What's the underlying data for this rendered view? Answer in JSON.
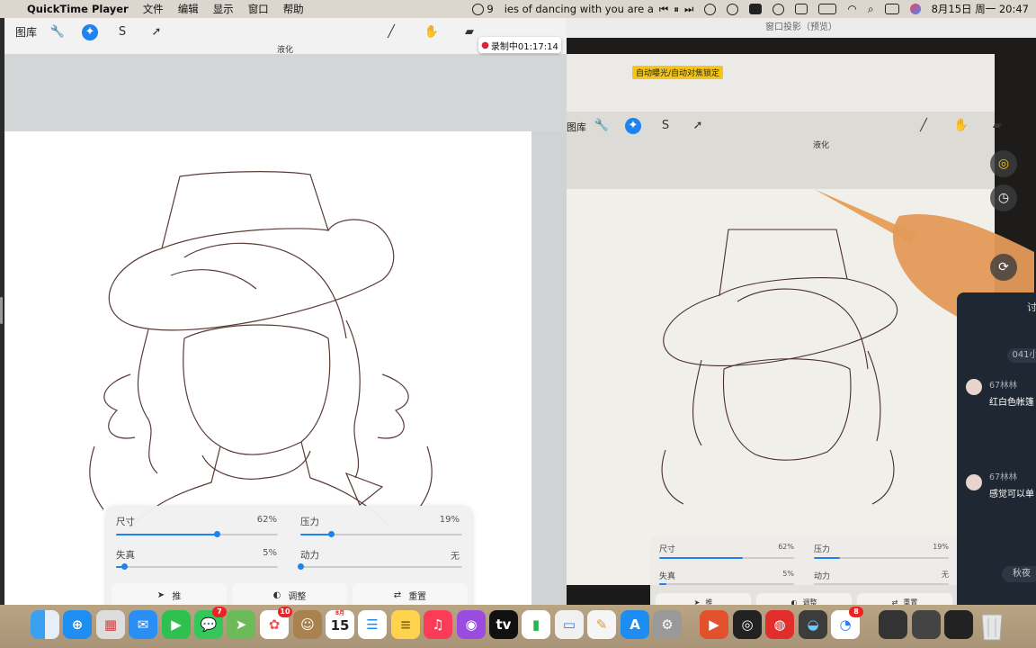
{
  "menubar": {
    "app_name": "QuickTime Player",
    "menus": [
      "文件",
      "编辑",
      "显示",
      "窗口",
      "帮助"
    ],
    "notif_count": "9",
    "now_playing": "ies of dancing with you are a",
    "date_time": "8月15日 周一  20:47"
  },
  "left_window": {
    "gallery_label": "图库",
    "mode_label": "液化",
    "recording_label": "录制中01:17:14",
    "liquify_panel": {
      "size_label": "尺寸",
      "size_value": "62%",
      "size_level": 0.62,
      "pressure_label": "压力",
      "pressure_value": "19%",
      "pressure_level": 0.19,
      "distortion_label": "失真",
      "distortion_value": "5%",
      "distortion_level": 0.05,
      "momentum_label": "动力",
      "momentum_value": "无",
      "momentum_level": 0.0,
      "push_label": "推",
      "adjust_label": "调整",
      "reset_label": "重置"
    }
  },
  "right_window": {
    "title": "窗口投影（预览）",
    "af_badge": "自动曝光/自动对焦锁定",
    "gallery_label": "图库",
    "mode_label": "液化",
    "panel": {
      "size_label": "尺寸",
      "size_value": "62%",
      "pressure_label": "压力",
      "pressure_value": "19%",
      "distortion_label": "失真",
      "distortion_value": "5%",
      "momentum_label": "动力",
      "momentum_value": "无",
      "push_label": "推",
      "adjust_label": "调整",
      "reset_label": "重置"
    }
  },
  "chat": {
    "title": "讨",
    "header_chip": "041小",
    "messages": [
      {
        "user": "67林林",
        "text": "红白色帐篷"
      },
      {
        "user": "67林林",
        "text": "感觉可以单"
      }
    ],
    "footer_chip": "秋夜"
  },
  "dock": {
    "calendar_month": "8月",
    "calendar_day": "15",
    "badges": {
      "facetime": "7",
      "photos": "10",
      "app_store": "8"
    }
  },
  "colors": {
    "accent": "#1e82f0",
    "recording": "#e0223b",
    "af_badge": "#f5c518"
  }
}
